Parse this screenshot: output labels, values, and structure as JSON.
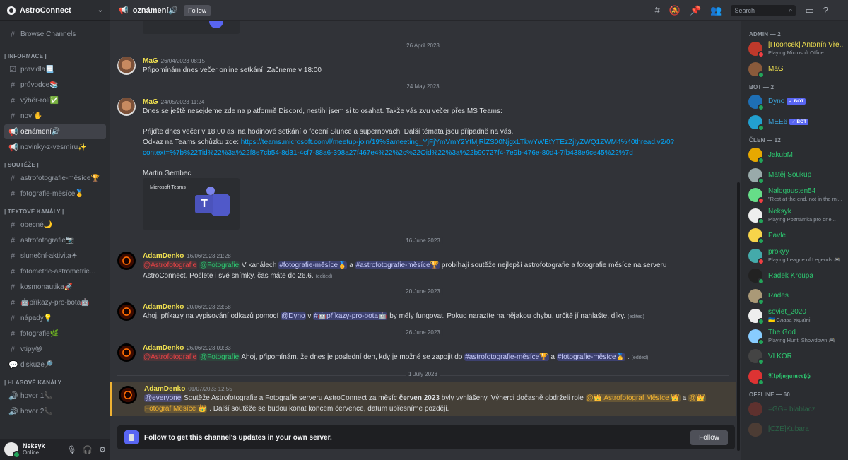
{
  "server": {
    "name": "AstroConnect"
  },
  "sidebar": {
    "browse": "Browse Channels",
    "categories": [
      {
        "title": "| INFORMACE |",
        "channels": [
          {
            "name": "pravidla📃",
            "icon": "rules-icon"
          },
          {
            "name": "průvodce📚",
            "icon": "hash-icon"
          },
          {
            "name": "výběr-rolí✅",
            "icon": "hash-icon"
          },
          {
            "name": "noví✋",
            "icon": "hash-icon"
          },
          {
            "name": "oznámení🔊",
            "icon": "announcement-icon",
            "active": true
          },
          {
            "name": "novinky-z-vesmíru✨",
            "icon": "announcement-icon"
          }
        ]
      },
      {
        "title": "| SOUTĚŽE |",
        "channels": [
          {
            "name": "astrofotografie-měsíce🏆",
            "icon": "hash-icon"
          },
          {
            "name": "fotografie-měsíce🥇",
            "icon": "hash-icon"
          }
        ]
      },
      {
        "title": "| TEXTOVÉ KANÁLY |",
        "channels": [
          {
            "name": "obecné🌙",
            "icon": "hash-icon"
          },
          {
            "name": "astrofotografie📷",
            "icon": "hash-icon"
          },
          {
            "name": "sluneční-aktivita☀",
            "icon": "hash-icon"
          },
          {
            "name": "fotometrie-astrometrie...",
            "icon": "hash-icon"
          },
          {
            "name": "kosmonautika🚀",
            "icon": "hash-icon"
          },
          {
            "name": "🤖příkazy-pro-bota🤖",
            "icon": "hash-icon"
          },
          {
            "name": "nápady💡",
            "icon": "hash-icon"
          },
          {
            "name": "fotografie🌿",
            "icon": "hash-icon"
          },
          {
            "name": "vtipy😁",
            "icon": "hash-icon"
          },
          {
            "name": "diskuze🔎",
            "icon": "forum-icon"
          }
        ]
      },
      {
        "title": "| HLASOVÉ KANÁLY |",
        "channels": [
          {
            "name": "hovor 1📞",
            "icon": "speaker-icon"
          },
          {
            "name": "hovor 2📞",
            "icon": "speaker-icon"
          }
        ]
      }
    ]
  },
  "user": {
    "name": "Neksyk",
    "status": "Online"
  },
  "topbar": {
    "channel": "oznámení🔊",
    "follow": "Follow",
    "search_placeholder": "Search"
  },
  "dividers": [
    "26 April 2023",
    "24 May 2023",
    "16 June 2023",
    "20 June 2023",
    "26 June 2023",
    "1 July 2023"
  ],
  "messages": {
    "m1": {
      "author": "MaG",
      "time": "26/04/2023 08:15",
      "text": "Připomínám dnes večer online setkání. Začneme v 18:00"
    },
    "m2": {
      "author": "MaG",
      "time": "24/05/2023 11:24",
      "l1": "Dnes se ještě nesejdeme zde na platformě Discord, nestihl jsem si to osahat. Takže vás zvu večer přes MS Teams:",
      "l2": "Přijďte dnes večer v 18:00 asi na hodinové setkání o focení Slunce a supernovách. Další témata jsou případně na vás.",
      "l3": "Odkaz na Teams schůzku zde: ",
      "link1": "https://teams.microsoft.com/l/meetup-join/19%3ameeting_YjFjYmVmY2YtMjRlZS00NjgxLTkwYWEtYTEzZjIyZWQ1ZWM4%40thread.v2/0?",
      "link2": "context=%7b%22Tid%22%3a%22f8e7cb54-8d31-4cf7-88a6-398a27f467e4%22%2c%22Oid%22%3a%22b90727f4-7e9b-476e-80d4-7fb438e9ce45%22%7d",
      "sign": "Martin Gembec",
      "embed": "Microsoft Teams"
    },
    "m3": {
      "author": "AdamDenko",
      "time": "16/06/2023 21:28",
      "m_role": "@Astrofotografie",
      "m_role2": "@Fotografie",
      "t1": " V kanálech ",
      "c1": "#fotografie-měsíce🥇",
      "t2": " a ",
      "c2": "#astrofotografie-měsíce🏆",
      "t3": " probíhají soutěže nejlepší astrofotografie a fotografie měsíce na serveru",
      "l2": "AstroConnect. Pošlete i své snímky, čas máte do 26.6.",
      "edited": "(edited)"
    },
    "m4": {
      "author": "AdamDenko",
      "time": "20/06/2023 23:58",
      "t1": "Ahoj, příkazy na vypisování odkazů pomocí ",
      "mention": "@Dyno",
      "t2": " v ",
      "c1": "#🤖příkazy-pro-bota🤖",
      "t3": " by měly fungovat. Pokud narazíte na nějakou chybu, určitě jí nahlašte, díky.",
      "edited": "(edited)"
    },
    "m5": {
      "author": "AdamDenko",
      "time": "26/06/2023 09:33",
      "m_role": "@Astrofotografie",
      "m_role2": "@Fotografie",
      "t1": " Ahoj, připomínám, že dnes je poslední den, kdy je možné se zapojit do ",
      "c1": "#astrofotografie-měsíce🏆",
      "t2": " a ",
      "c2": "#fotografie-měsíce🥇",
      "t3": " .",
      "edited": "(edited)"
    },
    "m6": {
      "author": "AdamDenko",
      "time": "01/07/2023 12:55",
      "everyone": "@everyone",
      "t1": " Soutěže Astrofotografie a Fotografie serveru AstroConnect za měsíc ",
      "bold": "červen 2023",
      "t2": " byly vyhlášeny. Výherci dočasně obdrželi role ",
      "r1": "@👑 Astrofotograf Měsíce 👑",
      "t3": " a ",
      "r2": "@👑",
      "r2b": "Fotograf Měsíce 👑",
      "t4": " . Další soutěže se budou konat koncem července, datum upřesníme později."
    }
  },
  "follow_bar": {
    "text": "Follow to get this channel's updates in your own server.",
    "button": "Follow"
  },
  "members": {
    "groups": [
      "ADMIN — 2",
      "BOT — 2",
      "ČLEN — 12",
      "OFFLINE — 60"
    ],
    "admin": [
      {
        "name": "[ITooncek] Antonín Vře...",
        "sub": "Playing Microsoft Office",
        "color": "#f0e050"
      },
      {
        "name": "MaG",
        "sub": "",
        "color": "#f0e050"
      }
    ],
    "bots": [
      {
        "name": "Dyno",
        "badge": "✓ BOT",
        "color": "#3ba0d6"
      },
      {
        "name": "MEE6",
        "badge": "✓ BOT",
        "color": "#3ba0d6"
      }
    ],
    "members": [
      {
        "name": "JakubM",
        "sub": "",
        "color": "#2dc770"
      },
      {
        "name": "Matěj Soukup",
        "sub": "",
        "color": "#2dc770"
      },
      {
        "name": "Nalogousten54",
        "sub": "\"Rest at the end, not in the mi...",
        "color": "#2dc770"
      },
      {
        "name": "Neksyk",
        "sub": "Playing Poznámka pro dne...",
        "color": "#2dc770"
      },
      {
        "name": "Pavle",
        "sub": "",
        "color": "#2dc770"
      },
      {
        "name": "prokyy",
        "sub": "Playing League of Legends 🎮",
        "color": "#2dc770"
      },
      {
        "name": "Radek Kroupa",
        "sub": "",
        "color": "#2dc770"
      },
      {
        "name": "Rades",
        "sub": "",
        "color": "#2dc770"
      },
      {
        "name": "soviet_2020",
        "sub": "🇺🇦 Слава Україні!",
        "color": "#2dc770"
      },
      {
        "name": "The God",
        "sub": "Playing Hunt: Showdown 🎮",
        "color": "#2dc770"
      },
      {
        "name": "VLKOR",
        "sub": "",
        "color": "#2dc770"
      },
      {
        "name": "𝕬𝖑𝖕𝖍𝖆𝖌𝖆𝖒𝖊𝖗𝖇𝖇",
        "sub": "",
        "color": "#2dc770"
      }
    ],
    "offline": [
      {
        "name": "=GG= blablacz",
        "color": "#2dc770"
      },
      {
        "name": "[CZE]Kubara",
        "color": "#2dc770"
      }
    ]
  }
}
